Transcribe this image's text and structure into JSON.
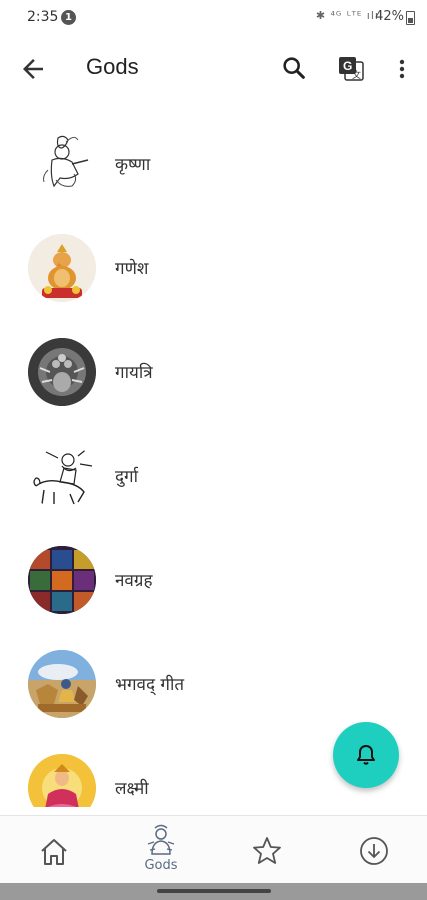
{
  "status": {
    "time": "2:35",
    "notification_count": "1",
    "network": "✱ ⁴ᴳ ᴸᵀᴱ ılıl",
    "battery": "42%"
  },
  "app_bar": {
    "title": "Gods",
    "icons": [
      "arrow-back-icon",
      "search-icon",
      "translate-icon",
      "more-vert-icon"
    ]
  },
  "gods": [
    {
      "label": "कृष्णा",
      "icon": "krishna-sketch"
    },
    {
      "label": "गणेश",
      "icon": "ganesh-image"
    },
    {
      "label": "गायत्रि",
      "icon": "gayatri-image"
    },
    {
      "label": "दुर्गा",
      "icon": "durga-sketch"
    },
    {
      "label": "नवग्रह",
      "icon": "navagraha-image"
    },
    {
      "label": "भगवद् गीत",
      "icon": "bhagavad-gita-image"
    },
    {
      "label": "लक्ष्मी",
      "icon": "lakshmi-image"
    }
  ],
  "fab": {
    "icon": "bell-icon",
    "color": "#1ecfc0"
  },
  "bottom_nav": {
    "items": [
      {
        "icon": "home-icon",
        "label": ""
      },
      {
        "icon": "gods-icon",
        "label": "Gods"
      },
      {
        "icon": "star-icon",
        "label": ""
      },
      {
        "icon": "download-icon",
        "label": ""
      }
    ],
    "active_color": "#5a6b82"
  }
}
